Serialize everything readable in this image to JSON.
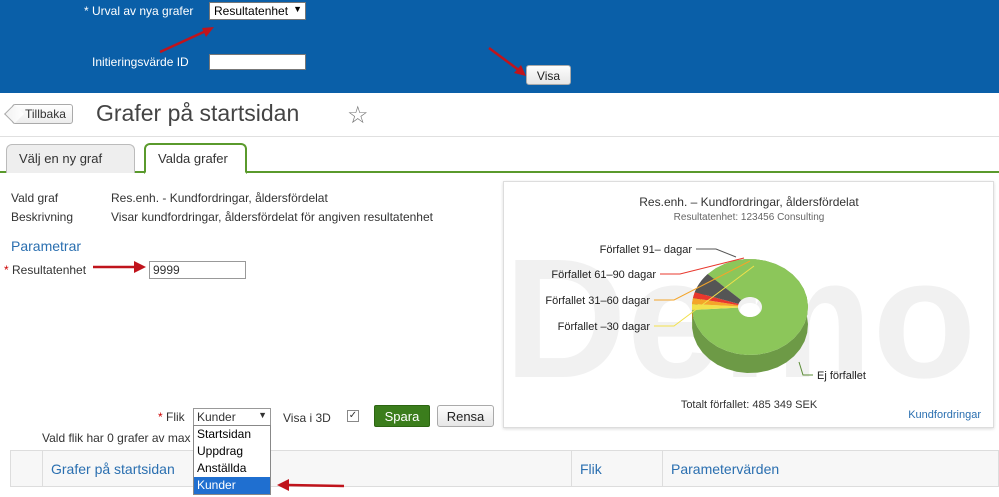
{
  "top_panel": {
    "selection_label": "* Urval av nya grafer",
    "selection_value": "Resultatenhet",
    "init_label": "Initieringsvärde ID",
    "init_value": "",
    "visa_button": "Visa"
  },
  "header": {
    "back_button": "Tillbaka",
    "page_title": "Grafer på startsidan"
  },
  "tabs": [
    {
      "label": "Välj en ny graf"
    },
    {
      "label": "Valda grafer"
    }
  ],
  "details": {
    "vald_graf_label": "Vald graf",
    "vald_graf_value": "Res.enh. - Kundfordringar, åldersfördelat",
    "beskrivning_label": "Beskrivning",
    "beskrivning_value": "Visar kundfordringar, åldersfördelat för angiven resultatenhet"
  },
  "params": {
    "heading": "Parametrar",
    "resultatenhet_label": "Resultatenhet",
    "resultatenhet_value": "9999"
  },
  "controls": {
    "flik_label": "Flik",
    "flik_value": "Kunder",
    "visa_3d_label": "Visa i 3D",
    "spara_button": "Spara",
    "rensa_button": "Rensa",
    "info_text": "Vald flik har 0 grafer av max",
    "dropdown_options": [
      "Startsidan",
      "Uppdrag",
      "Anställda",
      "Kunder"
    ],
    "dropdown_selected": "Kunder"
  },
  "table": {
    "columns": [
      "Grafer på startsidan",
      "Flik",
      "Parametervärden"
    ]
  },
  "chart_data": {
    "type": "pie",
    "title": "Res.enh. – Kundfordringar, åldersfördelat",
    "subtitle": "Resultatenhet: 123456 Consulting",
    "labels": [
      "Ej förfallet",
      "Förfallet –30 dagar",
      "Förfallet 31–60 dagar",
      "Förfallet 61–90 dagar",
      "Förfallet 91– dagar"
    ],
    "values": [
      87,
      2,
      2,
      2,
      7
    ],
    "colors": [
      "#8cc65a",
      "#f2e14a",
      "#f4a52a",
      "#e8382d",
      "#555555"
    ],
    "footer": "Totalt förfallet: 485 349 SEK",
    "link": "Kundfordringar",
    "watermark": "Demo"
  }
}
